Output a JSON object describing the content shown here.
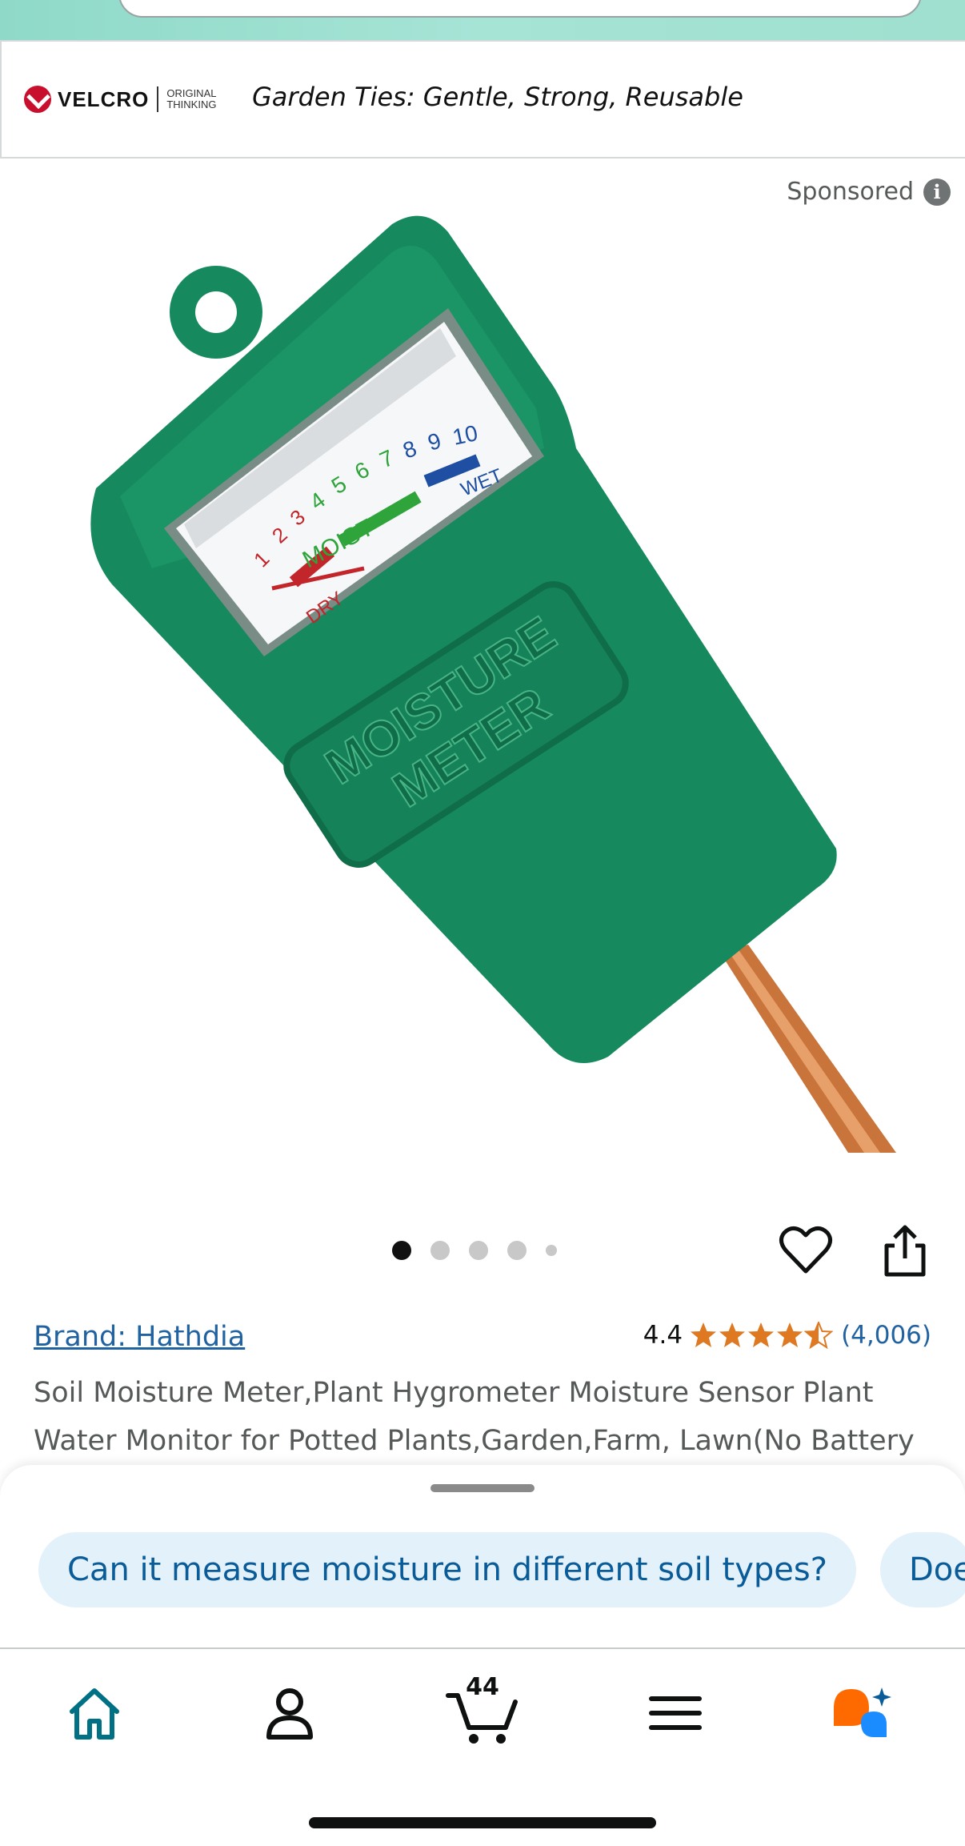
{
  "ad": {
    "brand_word": "VELCRO",
    "brand_tag_line1": "ORIGINAL",
    "brand_tag_line2": "THINKING",
    "text": "Garden Ties: Gentle, Strong, Reusable"
  },
  "sponsored_label": "Sponsored",
  "product_image": {
    "meter_label_line1": "MOISTURE",
    "meter_label_line2": "METER",
    "scale_dry": "DRY",
    "scale_moist": "MOIST",
    "scale_wet": "WET",
    "scale_numbers": [
      "1",
      "2",
      "3",
      "4",
      "5",
      "6",
      "7",
      "8",
      "9",
      "10"
    ],
    "colors": {
      "body": "#168a5e",
      "dry": "#c2262a",
      "moist": "#2ea43a",
      "wet": "#1e4fa3",
      "probe": "#c8743a"
    }
  },
  "gallery": {
    "total": 5,
    "active_index": 0
  },
  "product": {
    "brand": "Brand: Hathdia",
    "rating": "4.4",
    "rating_value": 4.4,
    "review_count": "(4,006)",
    "title": "Soil Moisture Meter,Plant Hygrometer Moisture Sensor Plant Water Monitor for Potted Plants,Garden,Farm, Lawn(No Battery"
  },
  "questions": [
    "Can it measure moisture in different soil types?",
    "Doe"
  ],
  "nav": {
    "cart_count": "44"
  },
  "colors": {
    "accent_teal": "#007185",
    "link_blue": "#2162a1",
    "star": "#de7921"
  }
}
